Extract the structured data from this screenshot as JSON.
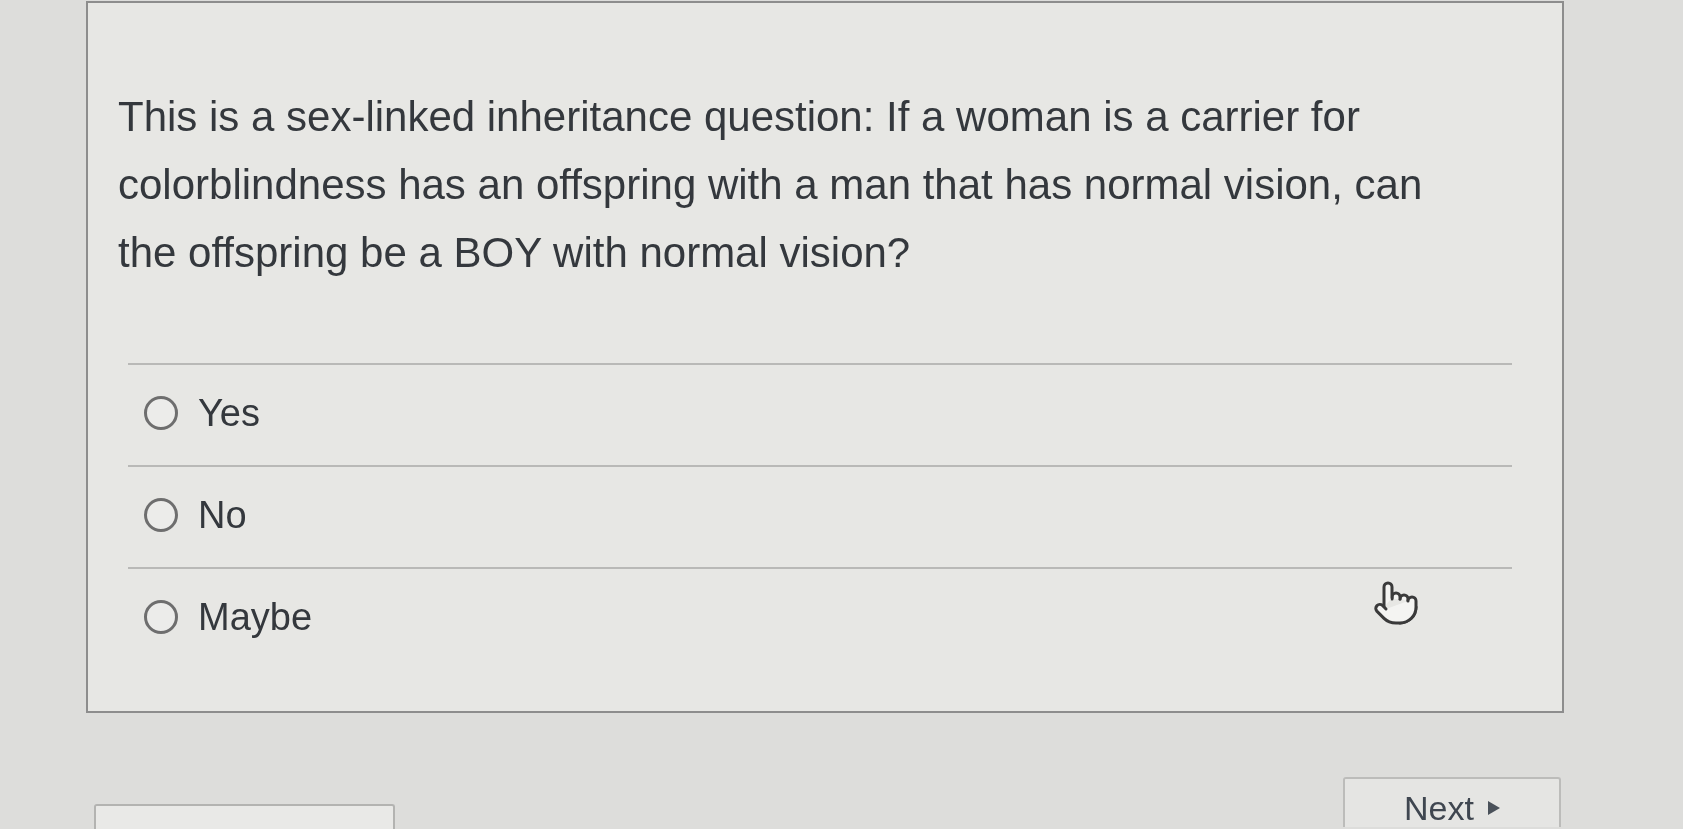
{
  "question": {
    "text": "This is a sex-linked inheritance question: If a woman is a carrier for colorblindness has an offspring with a man that has normal vision, can the offspring be a BOY with normal vision?"
  },
  "options": [
    {
      "label": "Yes",
      "selected": false
    },
    {
      "label": "No",
      "selected": false
    },
    {
      "label": "Maybe",
      "selected": false
    }
  ],
  "navigation": {
    "next": {
      "label": "Next"
    }
  }
}
